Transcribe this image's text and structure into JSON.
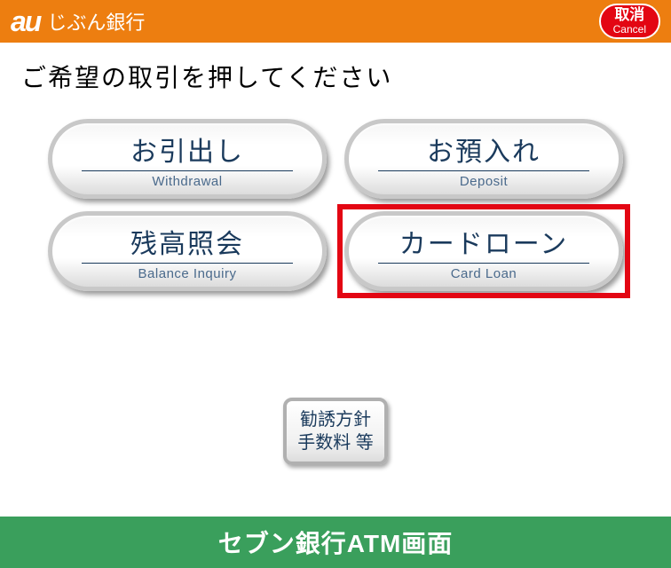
{
  "header": {
    "logo": "au",
    "bank_name": "じぶん銀行",
    "cancel": {
      "jp": "取消",
      "en": "Cancel"
    }
  },
  "prompt": "ご希望の取引を押してください",
  "buttons": {
    "withdrawal": {
      "jp": "お引出し",
      "en": "Withdrawal"
    },
    "deposit": {
      "jp": "お預入れ",
      "en": "Deposit"
    },
    "balance": {
      "jp": "残高照会",
      "en": "Balance Inquiry"
    },
    "loan": {
      "jp": "カードローン",
      "en": "Card Loan"
    }
  },
  "small_button": {
    "line1": "勧誘方針",
    "line2": "手数料 等"
  },
  "footer": "セブン銀行ATM画面"
}
